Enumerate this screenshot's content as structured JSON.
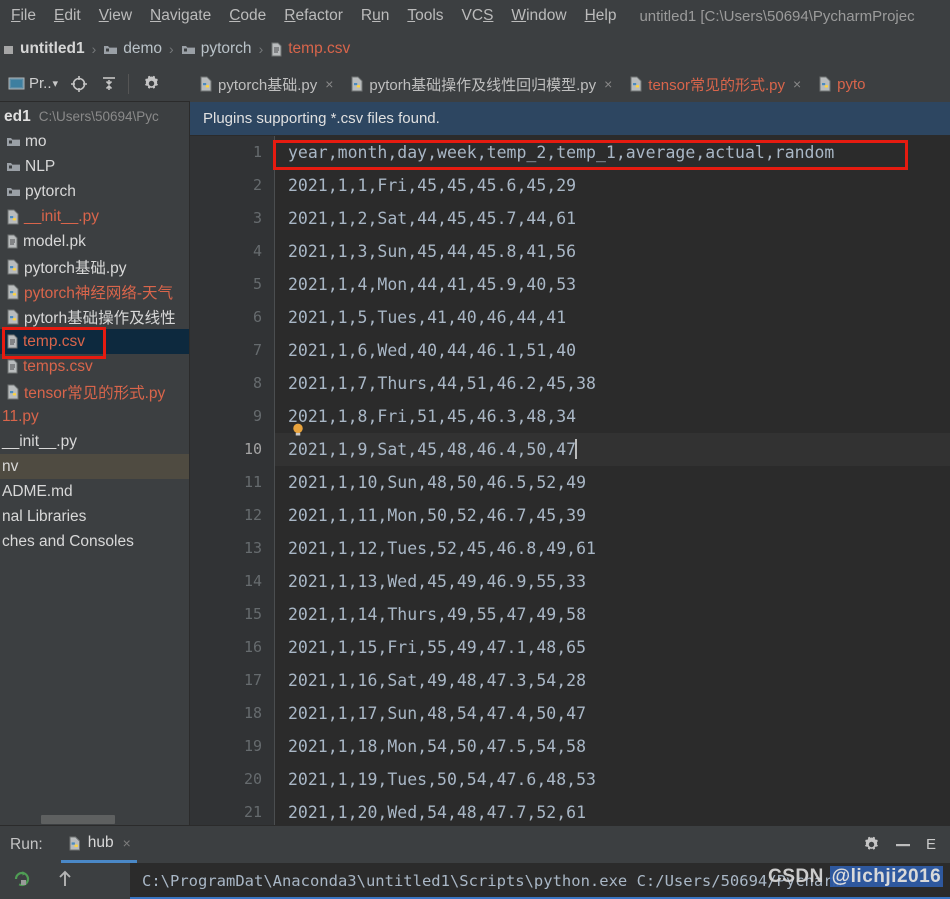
{
  "menu": {
    "items": [
      "File",
      "Edit",
      "View",
      "Navigate",
      "Code",
      "Refactor",
      "Run",
      "Tools",
      "VCS",
      "Window",
      "Help"
    ],
    "window_title": "untitled1 [C:\\Users\\50694\\PycharmProjec"
  },
  "breadcrumb": {
    "project": "untitled1",
    "folder1": "demo",
    "folder2": "pytorch",
    "file": "temp.csv",
    "separator": "›"
  },
  "project_panel": {
    "title": "Pr..",
    "dropdown_glyph": "▾",
    "root_label": "ed1",
    "root_path": "C:\\Users\\50694\\Pyc",
    "tree": [
      {
        "label": "mo",
        "type": "folder",
        "color": "white"
      },
      {
        "label": "NLP",
        "type": "folder",
        "color": "white"
      },
      {
        "label": "pytorch",
        "type": "folder",
        "color": "white"
      },
      {
        "label": "__init__.py",
        "type": "python",
        "color": "red"
      },
      {
        "label": "model.pk",
        "type": "file",
        "color": "white"
      },
      {
        "label": "pytorch基础.py",
        "type": "python",
        "color": "white"
      },
      {
        "label": "pytorch神经网络-天气",
        "type": "python",
        "color": "red"
      },
      {
        "label": "pytorh基础操作及线性",
        "type": "python",
        "color": "white"
      },
      {
        "label": "temp.csv",
        "type": "file",
        "color": "red",
        "selected": true
      },
      {
        "label": "temps.csv",
        "type": "file",
        "color": "red"
      },
      {
        "label": "tensor常见的形式.py",
        "type": "python",
        "color": "red"
      },
      {
        "label": "11.py",
        "type": "plain",
        "color": "red"
      },
      {
        "label": "__init__.py",
        "type": "plain",
        "color": "white"
      },
      {
        "label": "nv",
        "type": "plain",
        "color": "white",
        "inactive_selected": true
      },
      {
        "label": "ADME.md",
        "type": "plain",
        "color": "white"
      },
      {
        "label": "nal Libraries",
        "type": "plain",
        "color": "white"
      },
      {
        "label": "ches and Consoles",
        "type": "plain",
        "color": "white"
      }
    ]
  },
  "editor_tabs": [
    {
      "label": "pytorch基础.py",
      "active_color": false
    },
    {
      "label": "pytorh基础操作及线性回归模型.py",
      "active_color": false
    },
    {
      "label": "tensor常见的形式.py",
      "active_color": true
    },
    {
      "label": "pyto",
      "active_color": true
    }
  ],
  "tab_close_glyph": "×",
  "notification": {
    "message": "Plugins supporting *.csv files found."
  },
  "editor": {
    "current_line": 10,
    "highlight_line": 1,
    "lines": [
      {
        "n": 1,
        "text": "year,month,day,week,temp_2,temp_1,average,actual,random"
      },
      {
        "n": 2,
        "text": "2021,1,1,Fri,45,45,45.6,45,29"
      },
      {
        "n": 3,
        "text": "2021,1,2,Sat,44,45,45.7,44,61"
      },
      {
        "n": 4,
        "text": "2021,1,3,Sun,45,44,45.8,41,56"
      },
      {
        "n": 5,
        "text": "2021,1,4,Mon,44,41,45.9,40,53"
      },
      {
        "n": 6,
        "text": "2021,1,5,Tues,41,40,46,44,41"
      },
      {
        "n": 7,
        "text": "2021,1,6,Wed,40,44,46.1,51,40"
      },
      {
        "n": 8,
        "text": "2021,1,7,Thurs,44,51,46.2,45,38"
      },
      {
        "n": 9,
        "text": "2021,1,8,Fri,51,45,46.3,48,34"
      },
      {
        "n": 10,
        "text": "2021,1,9,Sat,45,48,46.4,50,47"
      },
      {
        "n": 11,
        "text": "2021,1,10,Sun,48,50,46.5,52,49"
      },
      {
        "n": 12,
        "text": "2021,1,11,Mon,50,52,46.7,45,39"
      },
      {
        "n": 13,
        "text": "2021,1,12,Tues,52,45,46.8,49,61"
      },
      {
        "n": 14,
        "text": "2021,1,13,Wed,45,49,46.9,55,33"
      },
      {
        "n": 15,
        "text": "2021,1,14,Thurs,49,55,47,49,58"
      },
      {
        "n": 16,
        "text": "2021,1,15,Fri,55,49,47.1,48,65"
      },
      {
        "n": 17,
        "text": "2021,1,16,Sat,49,48,47.3,54,28"
      },
      {
        "n": 18,
        "text": "2021,1,17,Sun,48,54,47.4,50,47"
      },
      {
        "n": 19,
        "text": "2021,1,18,Mon,54,50,47.5,54,58"
      },
      {
        "n": 20,
        "text": "2021,1,19,Tues,50,54,47.6,48,53"
      },
      {
        "n": 21,
        "text": "2021,1,20,Wed,54,48,47.7,52,61"
      }
    ]
  },
  "run_panel": {
    "label": "Run:",
    "tab_label": "hub",
    "close_glyph": "×",
    "edge_label": "E",
    "console_text": "C:\\ProgramDat\\Anaconda3\\untitled1\\Scripts\\python.exe C:/Users/50694/PycharmP"
  },
  "watermark": {
    "prefix": "CSDN ",
    "handle": "@lichji2016"
  },
  "colors": {
    "accent_red": "#d9654b",
    "selection_blue": "#0d293e",
    "highlight_box": "#e61b10",
    "notif_bg": "#2d4661",
    "editor_bg": "#2b2b2b",
    "chrome_bg": "#3c3f41"
  }
}
